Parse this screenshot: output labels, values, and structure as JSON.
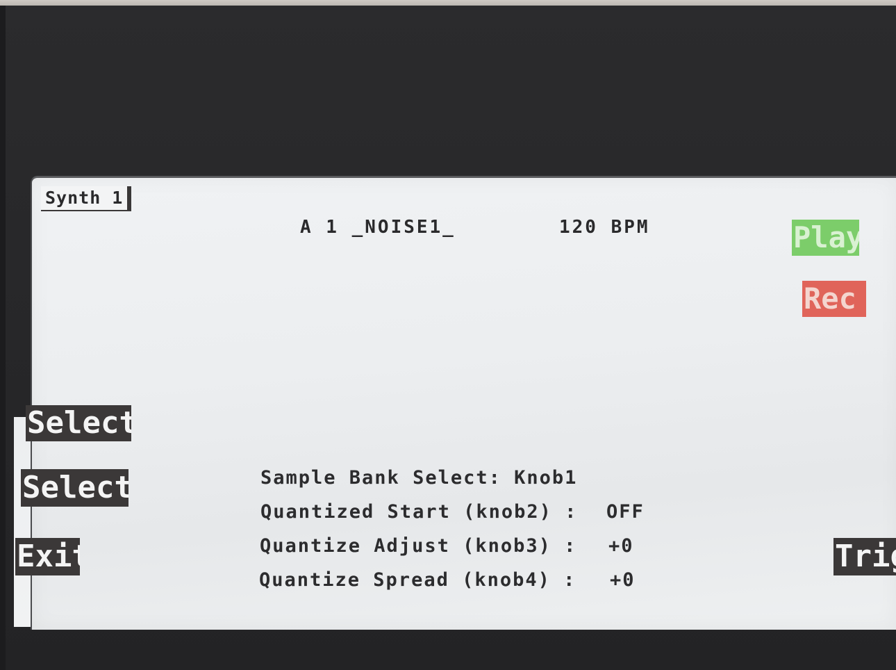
{
  "title": "Synth 1",
  "header": {
    "pattern": "A 1 _NOISE1_",
    "tempo": "120 BPM"
  },
  "transport": {
    "play_label": "Play",
    "rec_label": "Rec",
    "play_color": "#7ccd6a",
    "rec_color": "#e0645a"
  },
  "left_buttons": [
    "Select",
    "Select",
    "Exit"
  ],
  "right_buttons": [
    "Trig"
  ],
  "params": [
    {
      "label": "Sample Bank Select: Knob1",
      "value": ""
    },
    {
      "label": "Quantized Start (knob2) :",
      "value": "OFF"
    },
    {
      "label": "Quantize Adjust (knob3) :",
      "value": "+0"
    },
    {
      "label": "Quantize Spread (knob4) :",
      "value": "+0"
    }
  ]
}
